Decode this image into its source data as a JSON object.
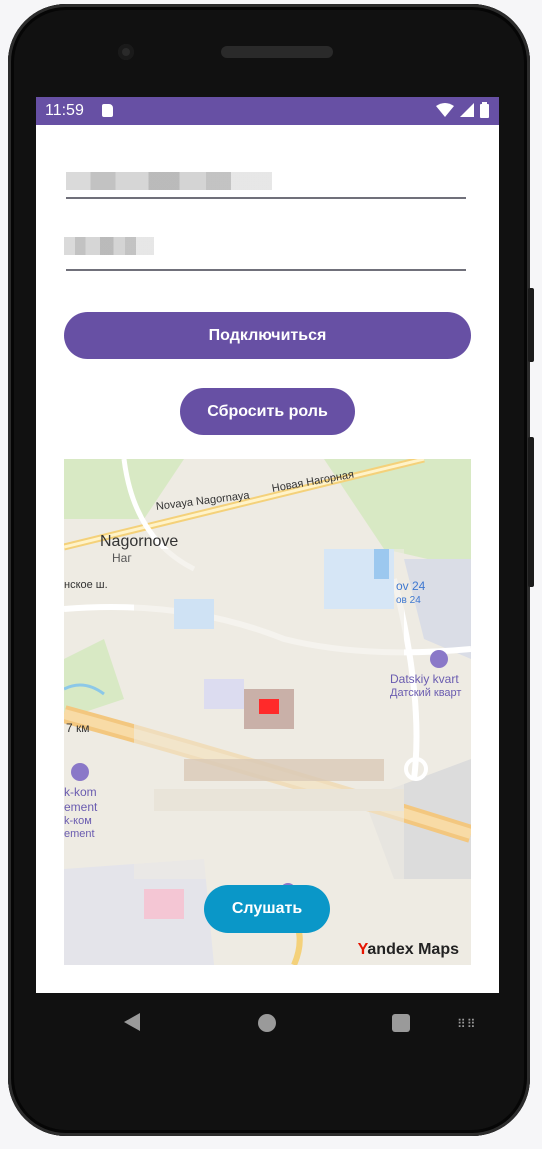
{
  "status_bar": {
    "time": "11:59",
    "icons": [
      "sd-card-icon",
      "wifi-icon",
      "signal-icon",
      "battery-icon"
    ]
  },
  "form": {
    "field1": {
      "value": "",
      "placeholder": ""
    },
    "field2": {
      "value": "",
      "placeholder": ""
    },
    "connect_label": "Подключиться",
    "reset_role_label": "Сбросить роль"
  },
  "map": {
    "labels": {
      "nagornoye": "Nagornove",
      "nagornoye_sub": "Наг",
      "street_en": "Novaya Nagornaya",
      "street_ru": "Новая Нагорная",
      "highway": "нское ш.",
      "km": "7 км",
      "datskiy_en": "Datskiy kvart",
      "datskiy_ru": "Датский кварт",
      "ov24_en": "ov 24",
      "ov24_ru": "ов 24",
      "komp1": "k-kom",
      "komp2": "ement",
      "komp3": "k-ком",
      "komp4": "ement"
    },
    "listen_label": "Слушать",
    "logo_y": "Y",
    "logo_rest": "andex Maps"
  },
  "colors": {
    "accent": "#6750a4",
    "listen": "#0a97c8"
  }
}
